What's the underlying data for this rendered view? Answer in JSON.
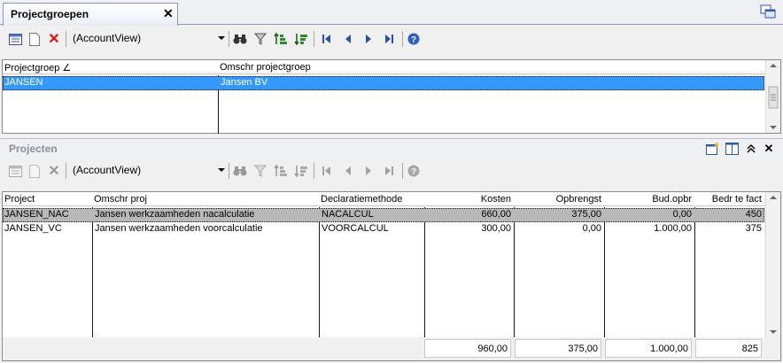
{
  "tab": {
    "title": "Projectgroepen",
    "close": "✕"
  },
  "toolbar1": {
    "combo_value": "(AccountView)"
  },
  "toolbar2": {
    "combo_value": "(AccountView)"
  },
  "grid1": {
    "headers": [
      "Projectgroep ∠",
      "Omschr projectgroep"
    ],
    "rows": [
      [
        "JANSEN",
        "Jansen BV"
      ]
    ]
  },
  "section2": {
    "title": "Projecten"
  },
  "grid2": {
    "headers": [
      "Project",
      "Omschr proj",
      "Declaratiemethode",
      "Kosten",
      "Opbrengst",
      "Bud.opbr",
      "Bedr te fact"
    ],
    "rows": [
      [
        "JANSEN_NAC",
        "Jansen werkzaamheden nacalculatie",
        "NACALCUL",
        "660,00",
        "375,00",
        "0,00",
        "450"
      ],
      [
        "JANSEN_VC",
        "Jansen werkzaamheden voorcalculatie",
        "VOORCALCUL",
        "300,00",
        "0,00",
        "1.000,00",
        "375"
      ]
    ],
    "totals": [
      "960,00",
      "375,00",
      "1.000,00",
      "825"
    ]
  },
  "colors": {
    "selection": "#3399ff",
    "selected_row_gray": "#b8b8b8"
  }
}
